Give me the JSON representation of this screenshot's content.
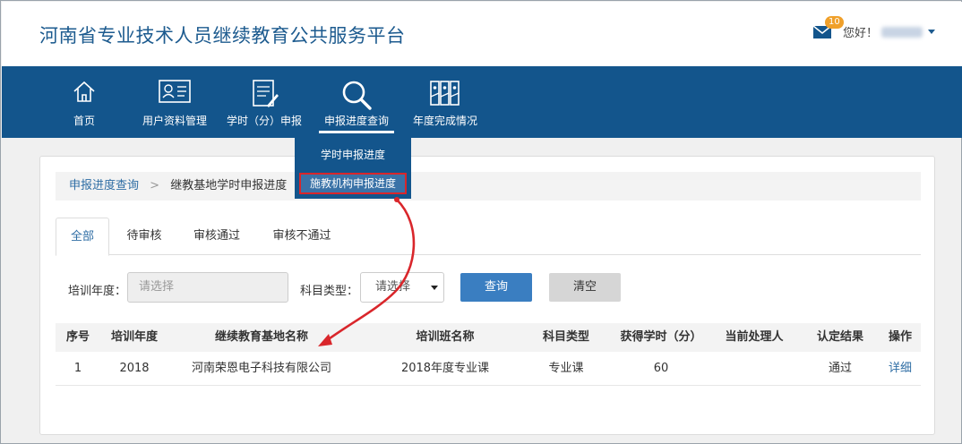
{
  "site": {
    "title": "河南省专业技术人员继续教育公共服务平台"
  },
  "user": {
    "badge_count": "10",
    "greeting": "您好！"
  },
  "nav": {
    "items": [
      {
        "label": "首页",
        "icon": "home-icon"
      },
      {
        "label": "用户资料管理",
        "icon": "id-card-icon"
      },
      {
        "label": "学时（分）申报",
        "icon": "document-edit-icon"
      },
      {
        "label": "申报进度查询",
        "icon": "magnifier-icon"
      },
      {
        "label": "年度完成情况",
        "icon": "binders-icon"
      }
    ],
    "active": "申报进度查询"
  },
  "dropdown": {
    "items": [
      {
        "label": "学时申报进度"
      },
      {
        "label": "施教机构申报进度"
      }
    ],
    "highlighted": "施教机构申报进度",
    "highlight_color": "#d9262b"
  },
  "breadcrumb": {
    "root": "申报进度查询",
    "separator": ">",
    "current": "继教基地学时申报进度"
  },
  "tabs": [
    {
      "label": "全部"
    },
    {
      "label": "待审核"
    },
    {
      "label": "审核通过"
    },
    {
      "label": "审核不通过"
    }
  ],
  "active_tab": "全部",
  "filters": {
    "year_label": "培训年度：",
    "year_placeholder": "请选择",
    "subject_label": "科目类型：",
    "subject_value": "请选择",
    "query_button": "查询",
    "clear_button": "清空"
  },
  "table": {
    "headers": [
      "序号",
      "培训年度",
      "继续教育基地名称",
      "培训班名称",
      "科目类型",
      "获得学时（分）",
      "当前处理人",
      "认定结果",
      "操作"
    ],
    "rows": [
      [
        "1",
        "2018",
        "河南荣恩电子科技有限公司",
        "2018年度专业课",
        "专业课",
        "60",
        "",
        "通过",
        "详细"
      ]
    ]
  },
  "colors": {
    "brand": "#13558c",
    "accent_link": "#2e6da4",
    "badge": "#f0a02a",
    "query_button": "#3a7ec1"
  }
}
